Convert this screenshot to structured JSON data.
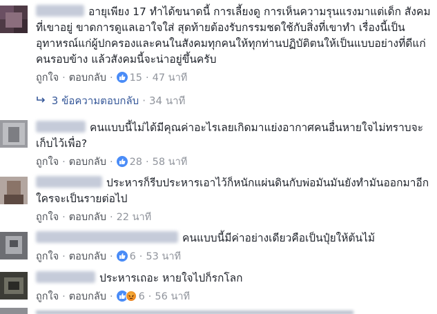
{
  "comments": [
    {
      "text": "อายุเพียง 17 ทำได้ขนาดนี้ การเลี้ยงดู การเห็นความรุนแรงมาแต่เด็ก สังคมที่เขาอยู่ ขาดการดูแลเอาใจใส่ สุดท้ายต้องรับกรรมชดใช้กับสิ่งที่เขาทำ เรื่องนี้เป็นอุทาหรณ์แก่ผู้ปกครองและคนในสังคมทุกคนให้ทุกท่านปฏิบัติตนให้เป็นแบบอย่างที่ดีแก่คนรอบข้าง แล้วสังคมนี้จะน่าอยู่ขึ้นครับ",
      "like_label": "ถูกใจ",
      "reply_label": "ตอบกลับ",
      "reaction_count": "15",
      "time": "47 นาที"
    },
    {
      "text": "คนแบบนี้ไม่ได้มีคุณค่าอะไรเลยเกิดมาแย่งอากาศคนอื่นหายใจไม่ทราบจะเก็บไว้เพื่อ?",
      "like_label": "ถูกใจ",
      "reply_label": "ตอบกลับ",
      "reaction_count": "28",
      "time": "58 นาที"
    },
    {
      "text": "ประหารก็รีบประหารเอาไว้ก็หนักแผ่นดินกับพ่อมันมันยังทำมันออกมาอีกใครจะเป็นรายต่อไป",
      "like_label": "ถูกใจ",
      "reply_label": "ตอบกลับ",
      "time": "22 นาที"
    },
    {
      "text": "คนแบบนี้มีค่าอย่างเดียวคือเป็นปุ๋ยให้ต้นไม้",
      "like_label": "ถูกใจ",
      "reply_label": "ตอบกลับ",
      "reaction_count": "6",
      "time": "53 นาที"
    },
    {
      "text": "ประหารเถอะ หายใจไปก็รกโลก",
      "like_label": "ถูกใจ",
      "reply_label": "ตอบกลับ",
      "reaction_count": "6",
      "time": "56 นาที"
    }
  ],
  "replies_summary": {
    "label": "3 ข้อความตอบกลับ",
    "time": "34 นาที"
  },
  "colors": {
    "link": "#365899",
    "meta": "#90949c",
    "like_blue": "#4a8cf7"
  },
  "icons": [
    "like-icon",
    "angry-icon",
    "reply-arrow-icon"
  ]
}
